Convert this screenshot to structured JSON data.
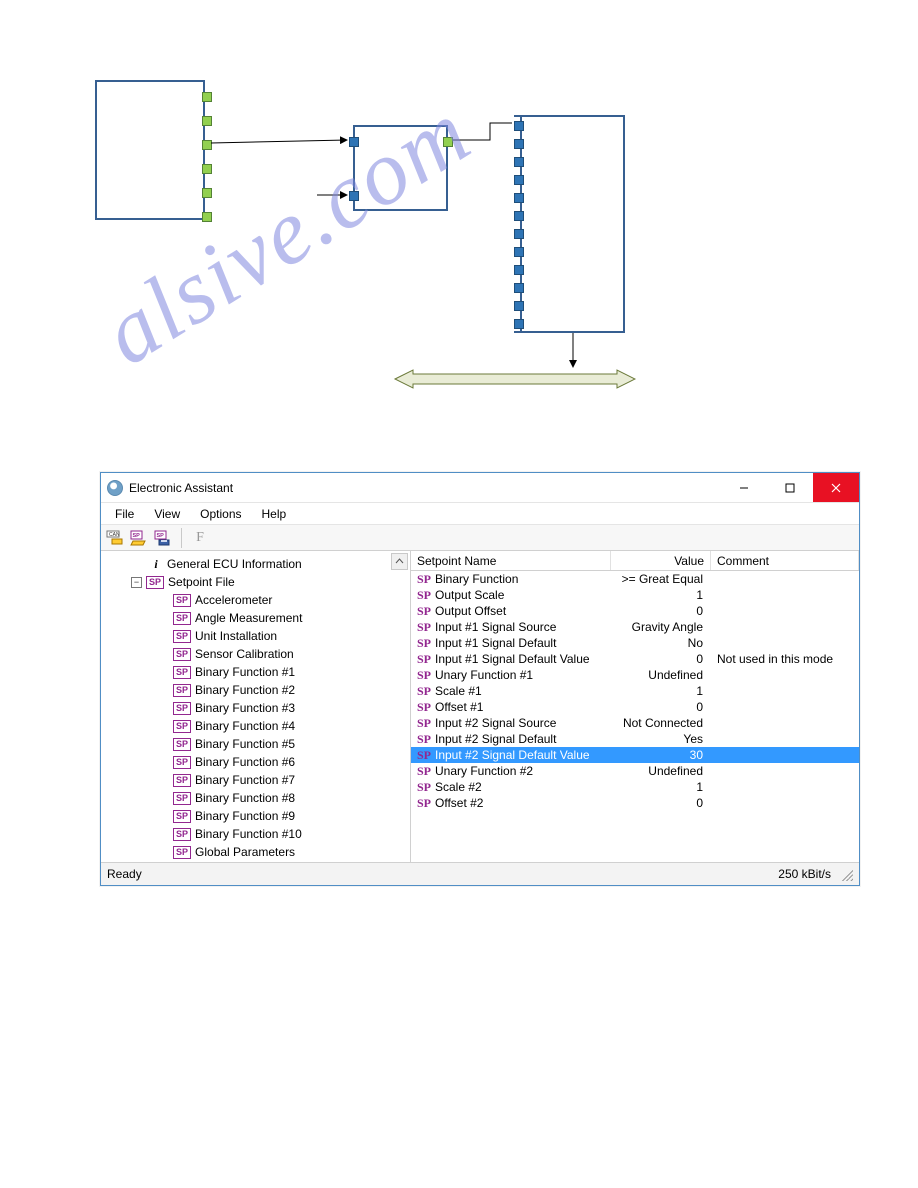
{
  "window": {
    "title": "Electronic Assistant",
    "menus": [
      "File",
      "View",
      "Options",
      "Help"
    ],
    "status_left": "Ready",
    "status_right": "250 kBit/s"
  },
  "tree": {
    "root_info": "General ECU Information",
    "setpoint_file": "Setpoint File",
    "items": [
      "Accelerometer",
      "Angle Measurement",
      "Unit Installation",
      "Sensor Calibration",
      "Binary Function #1",
      "Binary Function #2",
      "Binary Function #3",
      "Binary Function #4",
      "Binary Function #5",
      "Binary Function #6",
      "Binary Function #7",
      "Binary Function #8",
      "Binary Function #9",
      "Binary Function #10",
      "Global Parameters"
    ]
  },
  "grid": {
    "headers": {
      "name": "Setpoint Name",
      "value": "Value",
      "comment": "Comment"
    },
    "sp_prefix": "SP",
    "selected_index": 10,
    "rows": [
      {
        "name": "Binary Function",
        "value": ">= Great Equal",
        "comment": ""
      },
      {
        "name": "Output Scale",
        "value": "1",
        "comment": ""
      },
      {
        "name": "Output Offset",
        "value": "0",
        "comment": ""
      },
      {
        "name": "Input #1 Signal Source",
        "value": "Gravity Angle",
        "comment": ""
      },
      {
        "name": "Input #1 Signal Default",
        "value": "No",
        "comment": ""
      },
      {
        "name": "Input #1 Signal Default Value",
        "value": "0",
        "comment": "Not used in this mode"
      },
      {
        "name": "Unary Function #1",
        "value": "Undefined",
        "comment": ""
      },
      {
        "name": "Scale #1",
        "value": "1",
        "comment": ""
      },
      {
        "name": "Offset #1",
        "value": "0",
        "comment": ""
      },
      {
        "name": "Input #2 Signal Source",
        "value": "Not Connected",
        "comment": ""
      },
      {
        "name": "Input #2 Signal Default",
        "value": "Yes",
        "comment": ""
      },
      {
        "name": "Input #2 Signal Default Value",
        "value": "30",
        "comment": ""
      },
      {
        "name": "Unary Function #2",
        "value": "Undefined",
        "comment": ""
      },
      {
        "name": "Scale #2",
        "value": "1",
        "comment": ""
      },
      {
        "name": "Offset #2",
        "value": "0",
        "comment": ""
      }
    ]
  },
  "watermark": "          alsive.com"
}
